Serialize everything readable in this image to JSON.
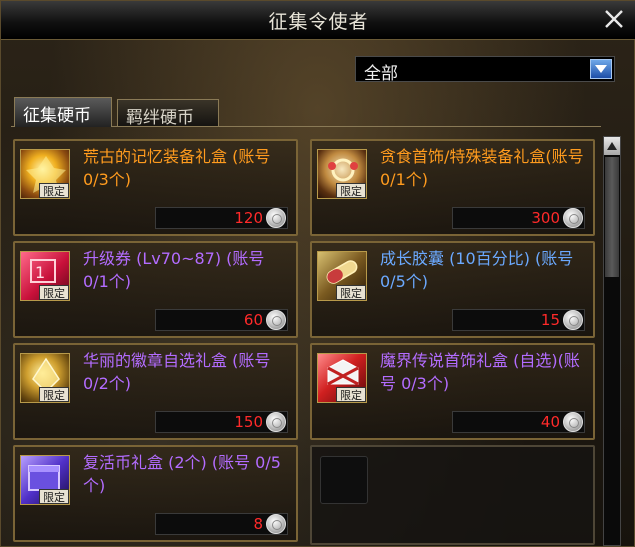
{
  "window": {
    "title": "征集令使者",
    "close_icon": "close-icon"
  },
  "filter": {
    "selected": "全部"
  },
  "tabs": [
    {
      "label": "征集硬币",
      "active": true
    },
    {
      "label": "羁绊硬币",
      "active": false
    }
  ],
  "items": [
    {
      "name": "荒古的记忆装备礼盒 (账号 0/3个)",
      "price": "120",
      "tag": "限定",
      "color": "#ff9b1e",
      "icon": "gold-gem-box-icon"
    },
    {
      "name": "贪食首饰/特殊装备礼盒(账号 0/1个)",
      "price": "300",
      "tag": "限定",
      "color": "#ff9b1e",
      "icon": "ornament-box-icon"
    },
    {
      "name": "升级券 (Lv70~87) (账号 0/1个)",
      "price": "60",
      "tag": "限定",
      "color": "#b36cff",
      "icon": "level-ticket-icon"
    },
    {
      "name": "成长胶囊 (10百分比) (账号 0/5个)",
      "price": "15",
      "tag": "限定",
      "color": "#6ba9ff",
      "icon": "growth-capsule-icon"
    },
    {
      "name": "华丽的徽章自选礼盒 (账号 0/2个)",
      "price": "150",
      "tag": "限定",
      "color": "#b36cff",
      "icon": "emblem-box-icon"
    },
    {
      "name": "魔界传说首饰礼盒 (自选)(账号 0/3个)",
      "price": "40",
      "tag": "限定",
      "color": "#b36cff",
      "icon": "legendary-box-icon"
    },
    {
      "name": "复活币礼盒 (2个) (账号 0/5个)",
      "price": "8",
      "tag": "限定",
      "color": "#b36cff",
      "icon": "revive-coin-box-icon"
    }
  ],
  "currency_icon": "silver-coin-icon"
}
